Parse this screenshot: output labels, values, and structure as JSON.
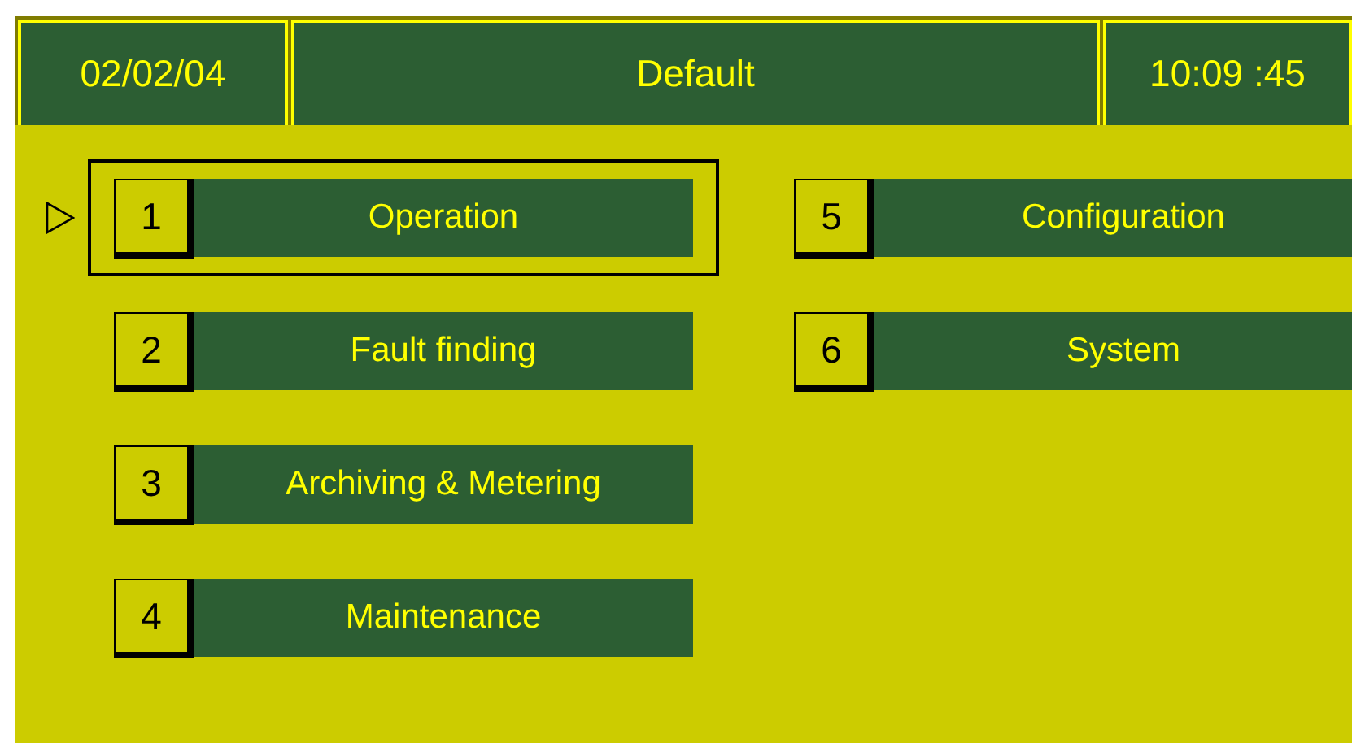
{
  "header": {
    "date": "02/02/04",
    "title": "Default",
    "time": "10:09 :45"
  },
  "menu": {
    "columns": [
      [
        {
          "number": "1",
          "label": "Operation",
          "selected": true
        },
        {
          "number": "2",
          "label": "Fault finding",
          "selected": false
        },
        {
          "number": "3",
          "label": "Archiving & Metering",
          "selected": false
        },
        {
          "number": "4",
          "label": "Maintenance",
          "selected": false
        }
      ],
      [
        {
          "number": "5",
          "label": "Configuration",
          "selected": false
        },
        {
          "number": "6",
          "label": "System",
          "selected": false
        }
      ]
    ]
  }
}
